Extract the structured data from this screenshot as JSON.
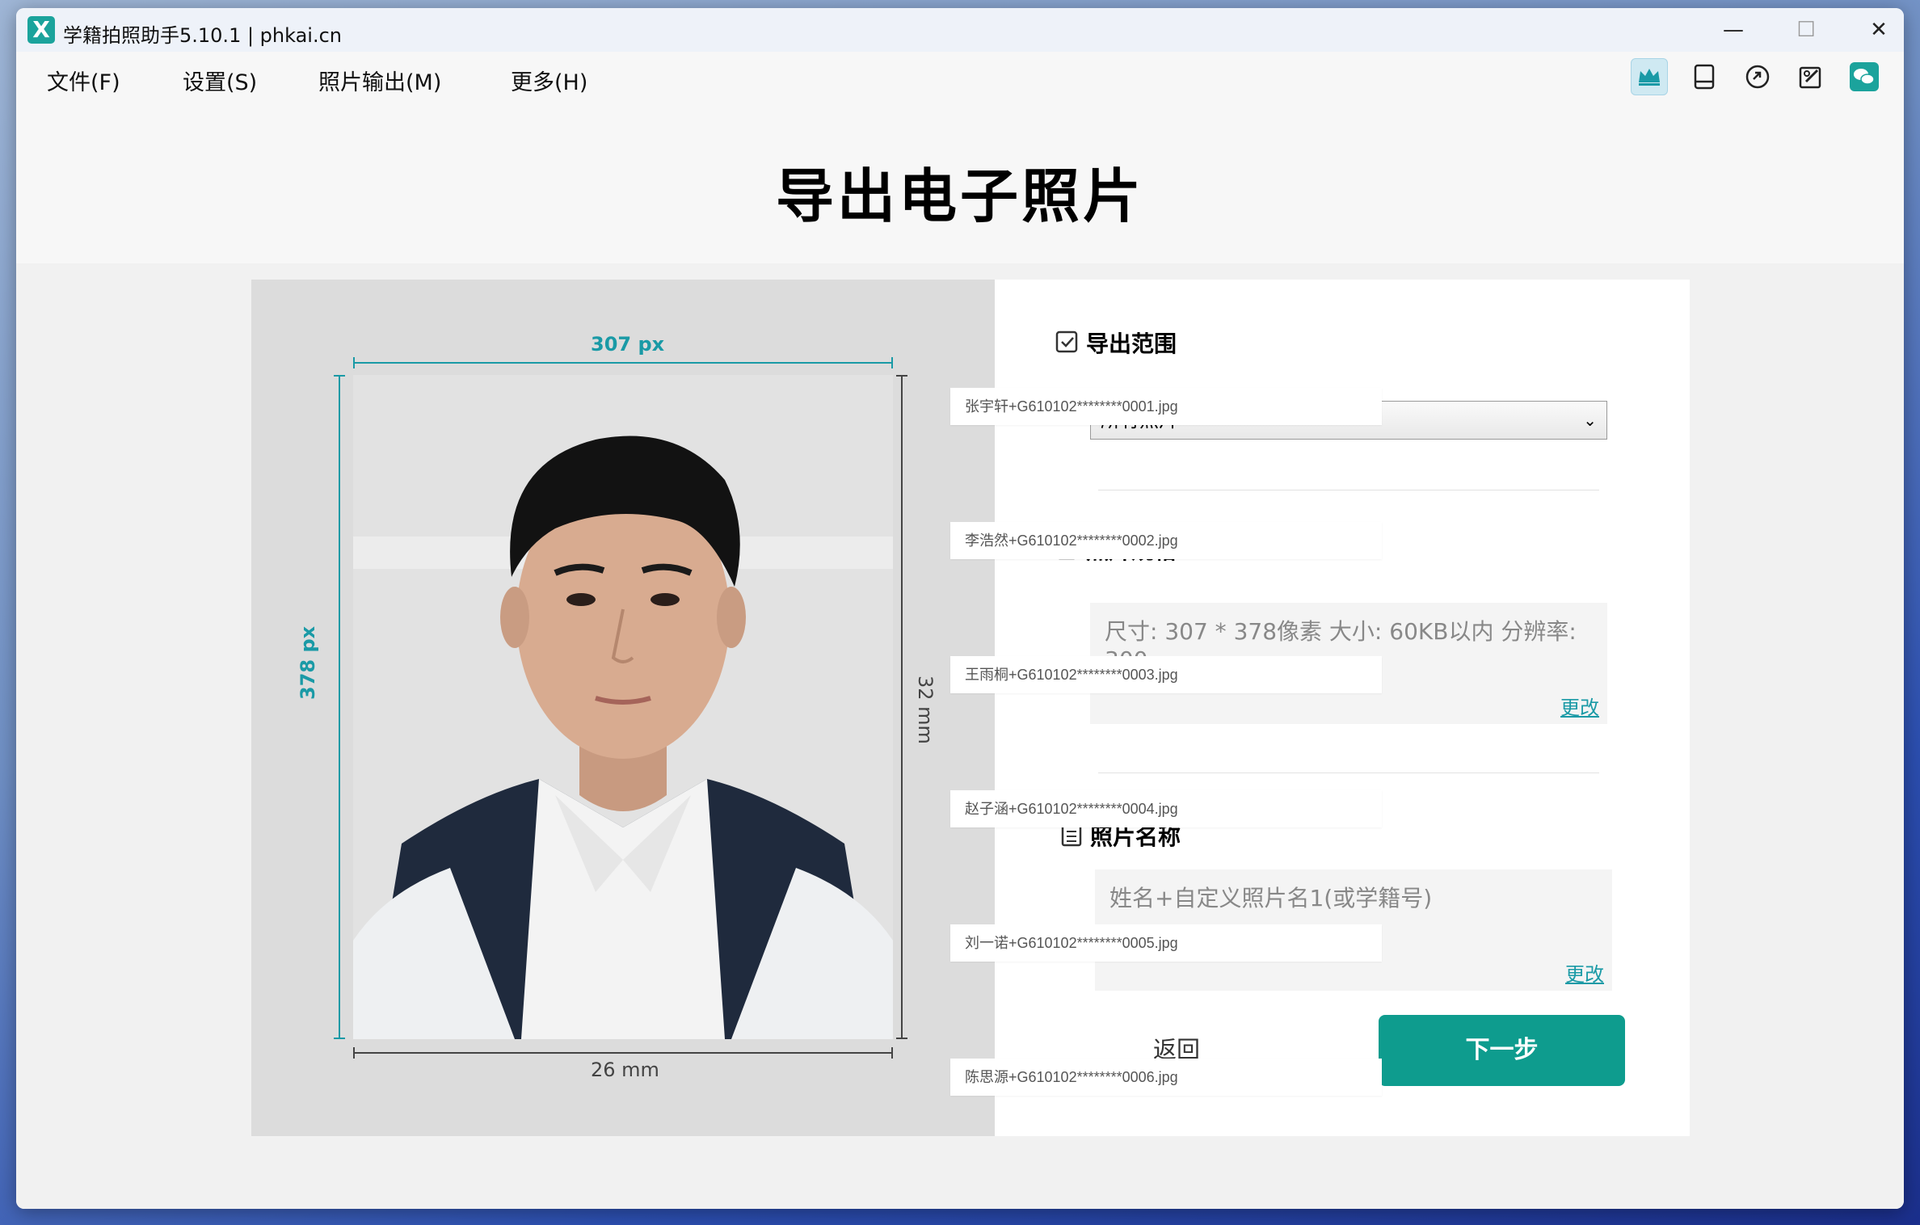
{
  "window": {
    "title": "学籍拍照助手5.10.1 | phkai.cn",
    "logo_letter": "X",
    "minimize": "—",
    "maximize": "☐",
    "close": "✕"
  },
  "menu": {
    "items": [
      "文件(F)",
      "设置(S)",
      "照片输出(M)",
      "更多(H)"
    ],
    "tool_icons": [
      "crown-icon",
      "tablet-icon",
      "link-icon",
      "edit-icon",
      "wechat-icon"
    ]
  },
  "page": {
    "title": "导出电子照片"
  },
  "preview": {
    "width_px": "307 px",
    "height_px": "378 px",
    "width_mm": "26 mm",
    "height_mm": "32 mm"
  },
  "settings": {
    "export_range": {
      "title": "导出范围",
      "selected": "所有照片"
    },
    "photo_spec": {
      "title": "照片规格",
      "text": "尺寸: 307 * 378像素  大小: 60KB以内  分辨率: 300",
      "change": "更改"
    },
    "photo_name": {
      "title": "照片名称",
      "text": "姓名+自定义照片名1(或学籍号)",
      "change": "更改"
    },
    "back": "返回",
    "next": "下一步"
  },
  "files": [
    "张宇轩+G610102********0001.jpg",
    "李浩然+G610102********0002.jpg",
    "王雨桐+G610102********0003.jpg",
    "赵子涵+G610102********0004.jpg",
    "刘一诺+G610102********0005.jpg",
    "陈思源+G610102********0006.jpg"
  ],
  "colors": {
    "accent": "#1a9aa6",
    "primary_button": "#0e9c8e"
  }
}
